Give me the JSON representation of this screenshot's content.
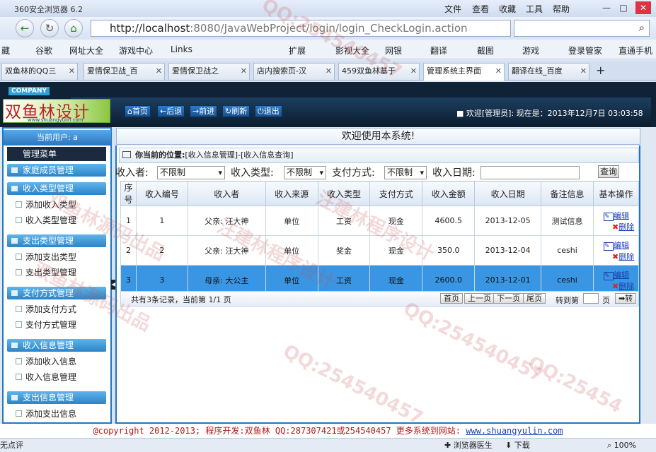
{
  "browser": {
    "title": "360安全浏览器 6.2",
    "menu": [
      "文件",
      "查看",
      "收藏",
      "工具",
      "帮助"
    ],
    "address_host": "http://localhost",
    "address_rest": ":8080/JavaWebProject/login/login_CheckLogin.action",
    "favorites": [
      "藏",
      "谷歌",
      "网址大全",
      "游戏中心",
      "Links"
    ],
    "favorites_right": [
      "扩展",
      "影视大全",
      "网银",
      "翻译",
      "截图",
      "游戏",
      "登录管家",
      "直通手机"
    ],
    "tabs": [
      "双鱼林的QQ三",
      "爱情保卫战_百",
      "爱情保卫战之",
      "店内搜索页-汉",
      "459双鱼林基于",
      "管理系统主界面",
      "翻译在线_百度"
    ]
  },
  "header": {
    "company": "COMPANY",
    "logo": "双鱼林设计",
    "logo_url": "www.shuangyulin.com",
    "nav": [
      "首页",
      "后退",
      "前进",
      "刷新",
      "退出"
    ],
    "welcome": "欢迎[管理员]:   现在是：2013年12月7日 03:03:58"
  },
  "sidebar": {
    "current_user": "当前用户: a",
    "main_menu": "管理菜单",
    "groups": [
      {
        "title": "家庭成员管理",
        "items": []
      },
      {
        "title": "收入类型管理",
        "items": [
          "添加收入类型",
          "收入类型管理"
        ]
      },
      {
        "title": "支出类型管理",
        "items": [
          "添加支出类型",
          "支出类型管理"
        ]
      },
      {
        "title": "支付方式管理",
        "items": [
          "添加支付方式",
          "支付方式管理"
        ]
      },
      {
        "title": "收入信息管理",
        "items": [
          "添加收入信息",
          "收入信息管理"
        ]
      },
      {
        "title": "支出信息管理",
        "items": [
          "添加支出信息"
        ]
      }
    ]
  },
  "main": {
    "welcome": "欢迎使用本系统!",
    "breadcrumb_label": "你当前的位置:",
    "breadcrumb": "[收入信息管理]-[收入信息查询]",
    "filters": {
      "payer_label": "收入者:",
      "payer_value": "不限制",
      "type_label": "收入类型:",
      "type_value": "不限制",
      "method_label": "支付方式:",
      "method_value": "不限制",
      "date_label": "收入日期:",
      "query": "查询"
    },
    "columns": [
      "序号",
      "收入编号",
      "收入者",
      "收入来源",
      "收入类型",
      "支付方式",
      "收入金额",
      "收入日期",
      "备注信息",
      "基本操作"
    ],
    "rows": [
      [
        "1",
        "1",
        "父亲: 汪大神",
        "单位",
        "工资",
        "现金",
        "4600.5",
        "2013-12-05",
        "测试信息"
      ],
      [
        "2",
        "2",
        "父亲: 汪大神",
        "单位",
        "奖金",
        "现金",
        "350.0",
        "2013-12-04",
        "ceshi"
      ],
      [
        "3",
        "3",
        "母亲: 大公主",
        "单位",
        "工资",
        "现金",
        "2600.0",
        "2013-12-01",
        "ceshi"
      ]
    ],
    "ops": {
      "edit": "编辑",
      "del": "删除"
    },
    "pager": {
      "record": "共有3条记录，当前第 1/1 页",
      "first": "首页",
      "prev": "上一页",
      "next": "下一页",
      "last": "尾页",
      "goto": "转到第",
      "page": "页",
      "go": "➡转"
    }
  },
  "footer": {
    "text": "@copyright 2012-2013; 程序开发:双鱼林  QQ:287307421或254540457  更多系统到网站:",
    "link": "www.shuangyulin.com"
  },
  "status": {
    "left": "无点评",
    "doctor": "浏览器医生",
    "download": "下载",
    "zoom": "100%"
  },
  "watermarks": [
    "QQ:254540457",
    "汪建林程序设计",
    "双鱼林源码出品",
    "QQ:254540457",
    "QQ:254540457",
    "汪建林程序设计",
    "双鱼林源码出品",
    "QQ:25454"
  ]
}
